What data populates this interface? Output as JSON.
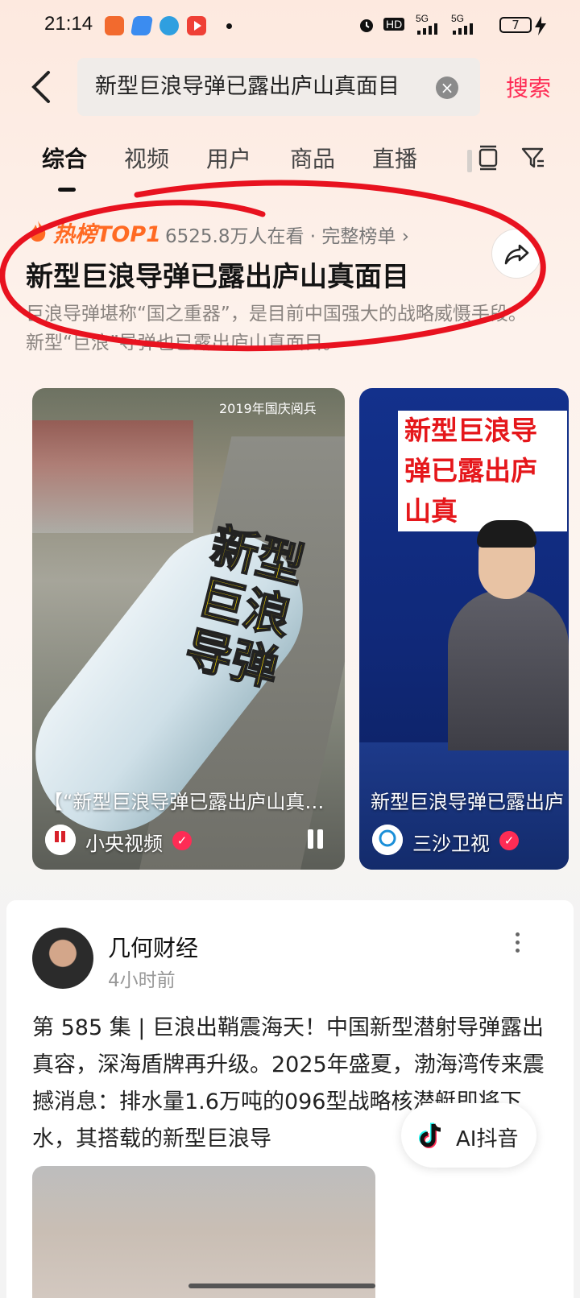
{
  "status_bar": {
    "time": "21:14",
    "hd": "HD",
    "net1": "5G",
    "net2": "5G",
    "battery": "7"
  },
  "search": {
    "query": "新型巨浪导弹已露出庐山真面目",
    "button_label": "搜索"
  },
  "tabs": [
    {
      "label": "综合",
      "active": true
    },
    {
      "label": "视频"
    },
    {
      "label": "用户"
    },
    {
      "label": "商品"
    },
    {
      "label": "直播"
    }
  ],
  "hot": {
    "badge": "热榜TOP1",
    "meta": "6525.8万人在看 · 完整榜单 ›",
    "title": "新型巨浪导弹已露出庐山真面目",
    "description": "巨浪导弹堪称“国之重器”，是目前中国强大的战略威慑手段。新型“巨浪”导弹也已露出庐山真面目。"
  },
  "videos": [
    {
      "overlay_year": "2019年国庆阅兵",
      "overlay_text": "新型巨浪导弹",
      "caption": "【“新型巨浪导弹已露出庐山真…",
      "author": "小央视频",
      "avatar_text": "小央视频"
    },
    {
      "overlay_text": "新型巨浪导弹已露出庐山真",
      "caption": "新型巨浪导弹已露出庐",
      "author": "三沙卫视",
      "avatar_text": "三沙卫视"
    }
  ],
  "post": {
    "author": "几何财经",
    "time": "4小时前",
    "body": "第 585 集 | 巨浪出鞘震海天！中国新型潜射导弹露出真容，深海盾牌再升级。2025年盛夏，渤海湾传来震撼消息：排水量1.6万吨的096型战略核潜艇即将下水，其搭载的新型巨浪导"
  },
  "ai_button": {
    "label": "AI抖音"
  },
  "colors": {
    "accent": "#fe2c55",
    "hot_orange": "#ff6a23",
    "annotation_red": "#e8121f"
  }
}
